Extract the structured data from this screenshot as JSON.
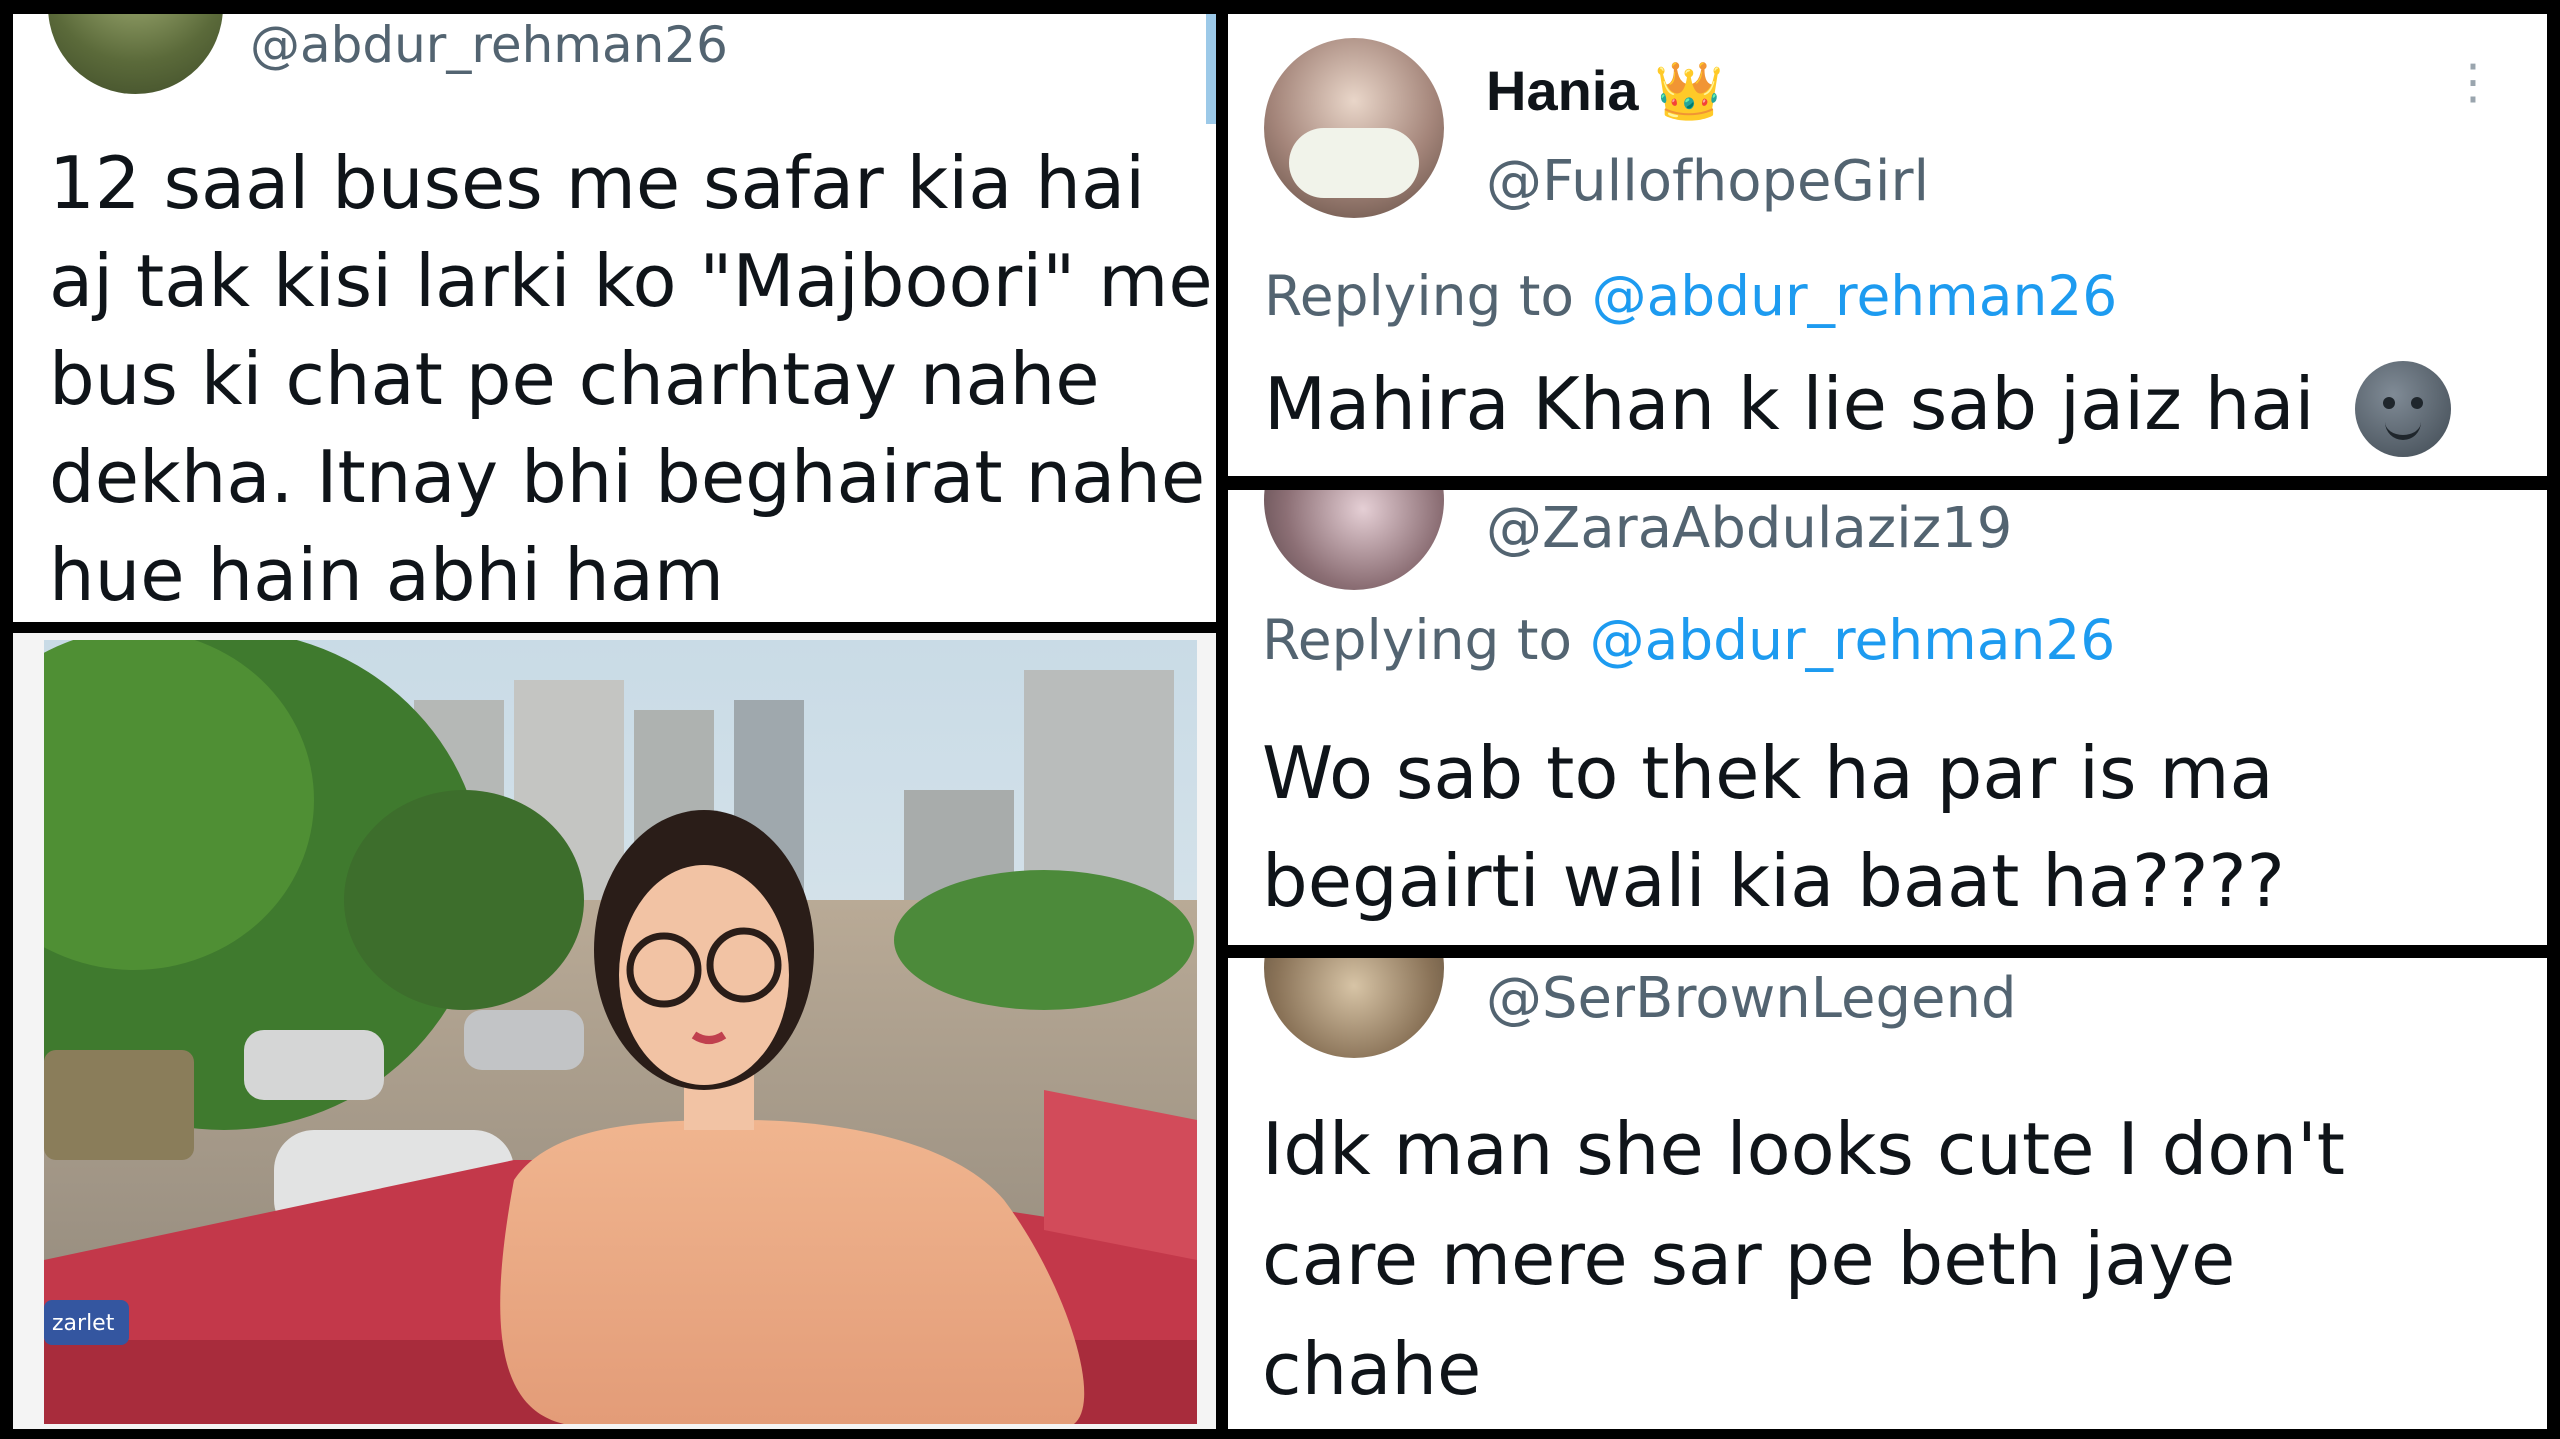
{
  "main_tweet": {
    "handle": "@abdur_rehman26",
    "lines": [
      "12 saal buses me safar kia hai",
      "aj tak kisi larki ko \"Majboori\" me",
      "bus ki chat pe charhtay nahe",
      "dekha. Itnay bhi beghairat nahe",
      "hue hain abhi ham"
    ]
  },
  "photo": {
    "billboard_text": "zarlet"
  },
  "replies": [
    {
      "name": "Hania",
      "badge": "crown-emoji",
      "handle": "@FullofhopeGirl",
      "replying_to_label": "Replying to",
      "replying_to_handle": "@abdur_rehman26",
      "lines": [
        "Mahira Khan k lie sab jaiz hai"
      ],
      "emoji": "moon-face-emoji"
    },
    {
      "handle": "@ZaraAbdulaziz19",
      "replying_to_label": "Replying to",
      "replying_to_handle": "@abdur_rehman26",
      "lines": [
        "Wo sab to thek ha par is ma",
        "begairti wali kia baat ha????"
      ]
    },
    {
      "handle": "@SerBrownLegend",
      "lines": [
        "Idk man she looks cute I don't",
        "care mere sar pe beth jaye",
        "chahe"
      ]
    }
  ],
  "colors": {
    "mention": "#1d9bf0",
    "muted": "#536471",
    "text": "#0f1419"
  }
}
